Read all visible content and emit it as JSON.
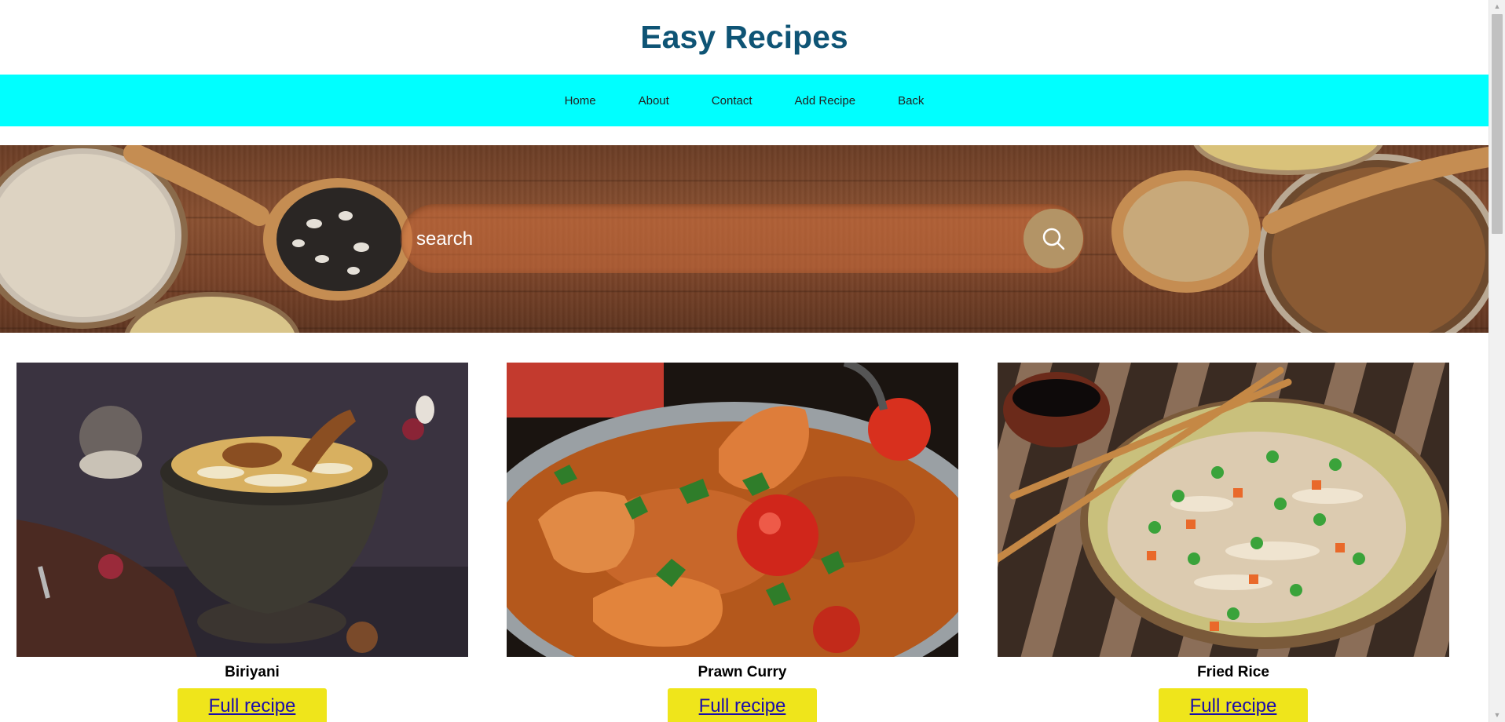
{
  "header": {
    "title": "Easy Recipes"
  },
  "nav": {
    "items": [
      {
        "label": "Home"
      },
      {
        "label": "About"
      },
      {
        "label": "Contact"
      },
      {
        "label": "Add Recipe"
      },
      {
        "label": "Back"
      }
    ]
  },
  "search": {
    "placeholder": "search",
    "icon": "search-icon"
  },
  "recipes": [
    {
      "title": "Biriyani",
      "button_label": "Full recipe"
    },
    {
      "title": "Prawn Curry",
      "button_label": "Full recipe"
    },
    {
      "title": "Fried Rice",
      "button_label": "Full recipe"
    }
  ],
  "colors": {
    "title": "#0e5475",
    "nav_background": "#00ffff",
    "button_background": "#efe51b",
    "link": "#1a0dab"
  }
}
